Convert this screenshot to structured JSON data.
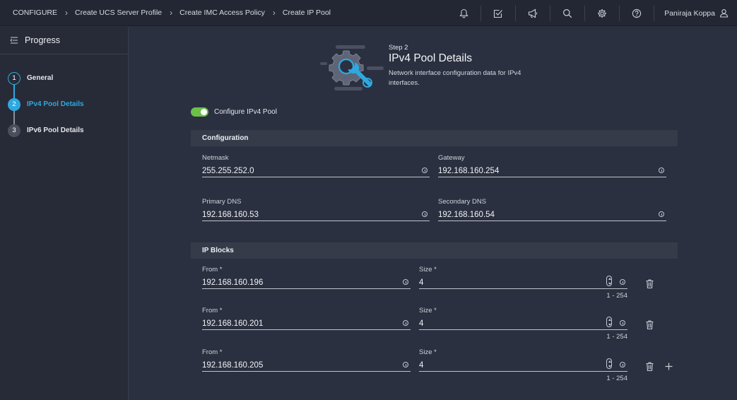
{
  "breadcrumb": [
    "CONFIGURE",
    "Create UCS Server Profile",
    "Create IMC Access Policy",
    "Create IP Pool"
  ],
  "user": {
    "name": "Paniraja Koppa"
  },
  "icons": [
    "bell-icon",
    "checklist-icon",
    "megaphone-icon",
    "search-icon",
    "gear-icon",
    "help-icon",
    "user-icon"
  ],
  "sidebar": {
    "title": "Progress",
    "steps": [
      {
        "num": "1",
        "label": "General",
        "state": "complete"
      },
      {
        "num": "2",
        "label": "IPv4 Pool Details",
        "state": "active"
      },
      {
        "num": "3",
        "label": "IPv6 Pool Details",
        "state": "pending"
      }
    ]
  },
  "header": {
    "step": "Step 2",
    "title": "IPv4 Pool Details",
    "description": "Network interface configuration data for IPv4 interfaces."
  },
  "toggle": {
    "label": "Configure IPv4 Pool",
    "on": true
  },
  "configuration": {
    "title": "Configuration",
    "netmask": {
      "label": "Netmask",
      "value": "255.255.252.0"
    },
    "gateway": {
      "label": "Gateway",
      "value": "192.168.160.254"
    },
    "primary_dns": {
      "label": "Primary DNS",
      "value": "192.168.160.53"
    },
    "secondary_dns": {
      "label": "Secondary DNS",
      "value": "192.168.160.54"
    }
  },
  "ip_blocks": {
    "title": "IP Blocks",
    "blocks": [
      {
        "from_label": "From *",
        "from": "192.168.160.196",
        "size_label": "Size *",
        "size": "4",
        "range": "1 - 254"
      },
      {
        "from_label": "From *",
        "from": "192.168.160.201",
        "size_label": "Size *",
        "size": "4",
        "range": "1 - 254"
      },
      {
        "from_label": "From *",
        "from": "192.168.160.205",
        "size_label": "Size *",
        "size": "4",
        "range": "1 - 254"
      }
    ]
  },
  "colors": {
    "accent": "#2fa8e0",
    "toggle_on": "#6cc04a",
    "background": "#2b3040",
    "topbar": "#232733"
  }
}
